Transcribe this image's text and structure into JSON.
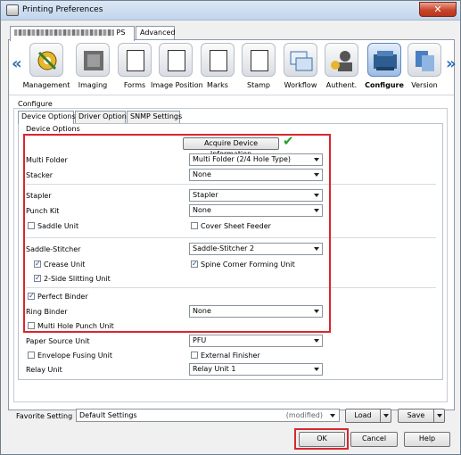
{
  "window": {
    "title": "Printing Preferences",
    "close_glyph": "✕"
  },
  "main_tabs": [
    {
      "label": "PS",
      "redacted_prefix": true
    },
    {
      "label": "Advanced"
    }
  ],
  "iconbar": {
    "left_arrow": "«",
    "right_arrow": "»",
    "items": [
      {
        "label": "Management",
        "icon": "management-icon"
      },
      {
        "label": "Imaging",
        "icon": "imaging-icon"
      },
      {
        "label": "Forms",
        "icon": "forms-icon"
      },
      {
        "label": "Image Position",
        "icon": "image-position-icon"
      },
      {
        "label": "Marks",
        "icon": "marks-icon"
      },
      {
        "label": "Stamp",
        "icon": "stamp-icon"
      },
      {
        "label": "Workflow",
        "icon": "workflow-icon"
      },
      {
        "label": "Authent.",
        "icon": "authentication-icon"
      },
      {
        "label": "Configure",
        "icon": "configure-icon",
        "active": true
      },
      {
        "label": "Version",
        "icon": "version-icon"
      }
    ]
  },
  "configure": {
    "label": "Configure",
    "tabs": [
      "Device Options",
      "Driver Options",
      "SNMP Settings"
    ],
    "device_options_legend": "Device Options",
    "acquire_button": "Acquire Device Information",
    "acquire_status": "✔",
    "multi_folder": {
      "label": "Multi Folder",
      "value": "Multi Folder (2/4 Hole Type)"
    },
    "stacker": {
      "label": "Stacker",
      "value": "None"
    },
    "stapler": {
      "label": "Stapler",
      "value": "Stapler"
    },
    "punch_kit": {
      "label": "Punch Kit",
      "value": "None"
    },
    "saddle_unit": {
      "label": "Saddle Unit",
      "checked": false
    },
    "cover_sheet_feeder": {
      "label": "Cover Sheet Feeder",
      "checked": false
    },
    "saddle_stitcher": {
      "label": "Saddle-Stitcher",
      "value": "Saddle-Stitcher 2"
    },
    "crease_unit": {
      "label": "Crease Unit",
      "checked": true
    },
    "spine_corner": {
      "label": "Spine Corner Forming Unit",
      "checked": true
    },
    "two_side_slitting": {
      "label": "2-Side Slitting Unit",
      "checked": true
    },
    "perfect_binder": {
      "label": "Perfect Binder",
      "checked": true
    },
    "ring_binder": {
      "label": "Ring Binder",
      "value": "None"
    },
    "multi_hole_punch": {
      "label": "Multi Hole Punch Unit",
      "checked": false
    },
    "paper_source_unit": {
      "label": "Paper Source Unit",
      "value": "PFU"
    },
    "envelope_fusing": {
      "label": "Envelope Fusing Unit",
      "checked": false
    },
    "external_finisher": {
      "label": "External Finisher",
      "checked": false
    },
    "relay_unit": {
      "label": "Relay Unit",
      "value": "Relay Unit 1"
    }
  },
  "favorite": {
    "label": "Favorite Setting",
    "value": "Default Settings",
    "status": "(modified)",
    "load": "Load",
    "save": "Save"
  },
  "buttons": {
    "ok": "OK",
    "cancel": "Cancel",
    "help": "Help"
  },
  "colors": {
    "highlight_red": "#d9262e",
    "check_green": "#25a32c"
  }
}
